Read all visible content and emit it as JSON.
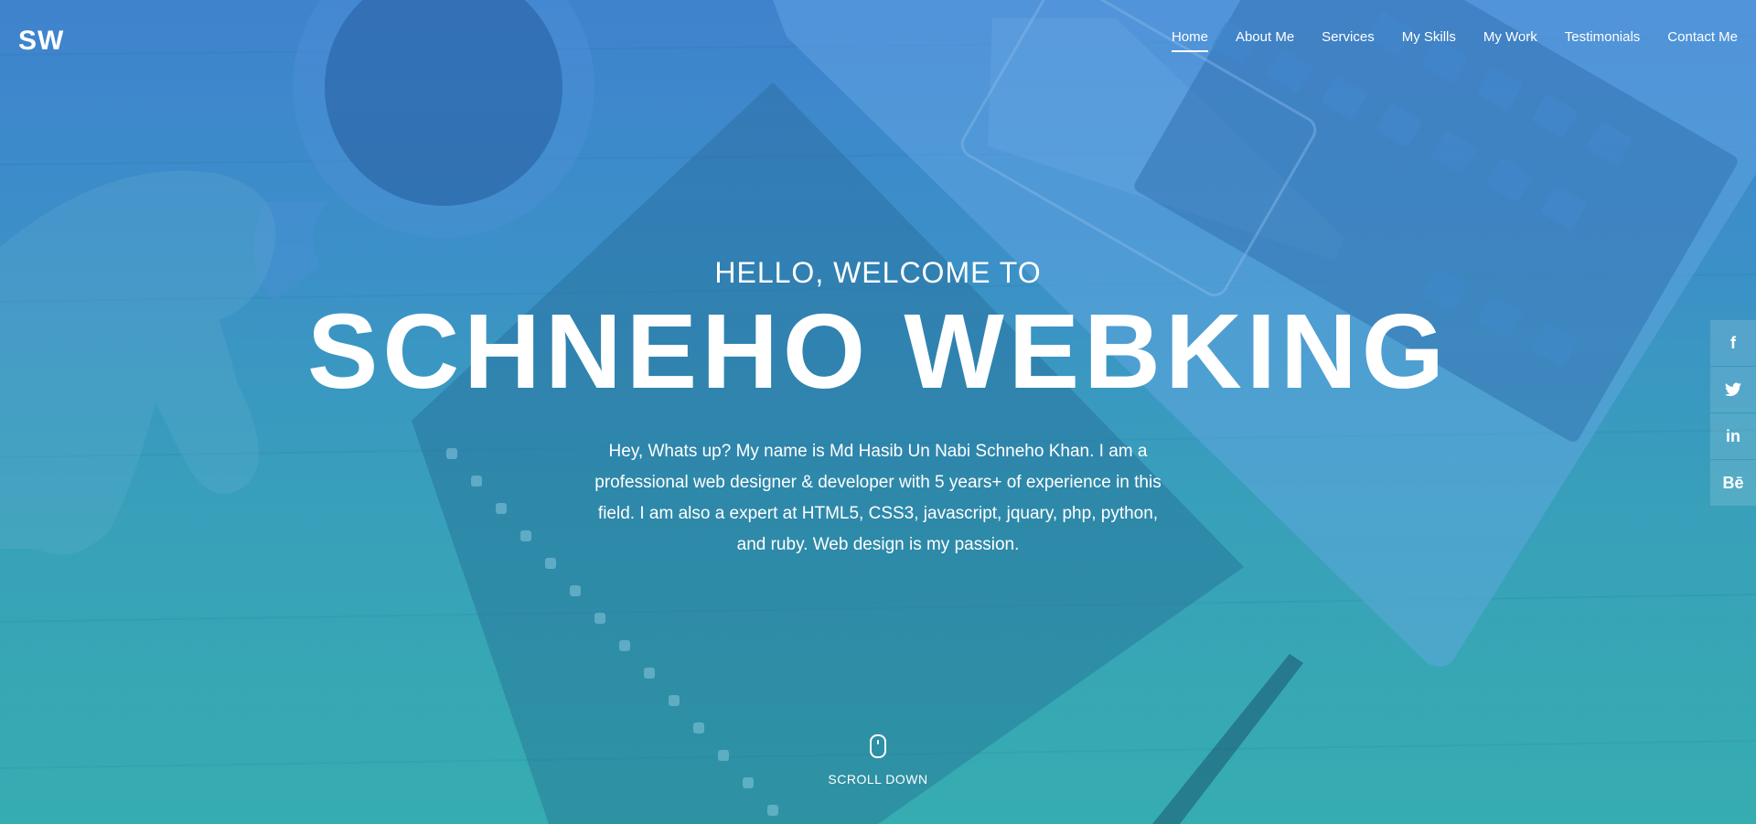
{
  "header": {
    "logo": "SW",
    "nav": [
      {
        "label": "Home",
        "active": true
      },
      {
        "label": "About Me"
      },
      {
        "label": "Services"
      },
      {
        "label": "My Skills"
      },
      {
        "label": "My Work"
      },
      {
        "label": "Testimonials"
      },
      {
        "label": "Contact Me"
      }
    ]
  },
  "hero": {
    "welcome": "HELLO, WELCOME TO",
    "name": "SCHNEHO WEBKING",
    "intro": "Hey, Whats up? My name is Md Hasib Un Nabi Schneho Khan. I am a professional web designer & developer with 5 years+ of experience in this field. I am also a expert at HTML5, CSS3, javascript, jquary, php, python, and ruby. Web design is my passion."
  },
  "social": {
    "facebook": "f",
    "twitter": "🐦",
    "linkedin": "in",
    "behance": "Bē"
  },
  "scroll": {
    "label": "SCROLL DOWN"
  },
  "colors": {
    "gradient_top": "#3d7fc9",
    "gradient_bottom": "#37acb0",
    "text": "#ffffff"
  }
}
